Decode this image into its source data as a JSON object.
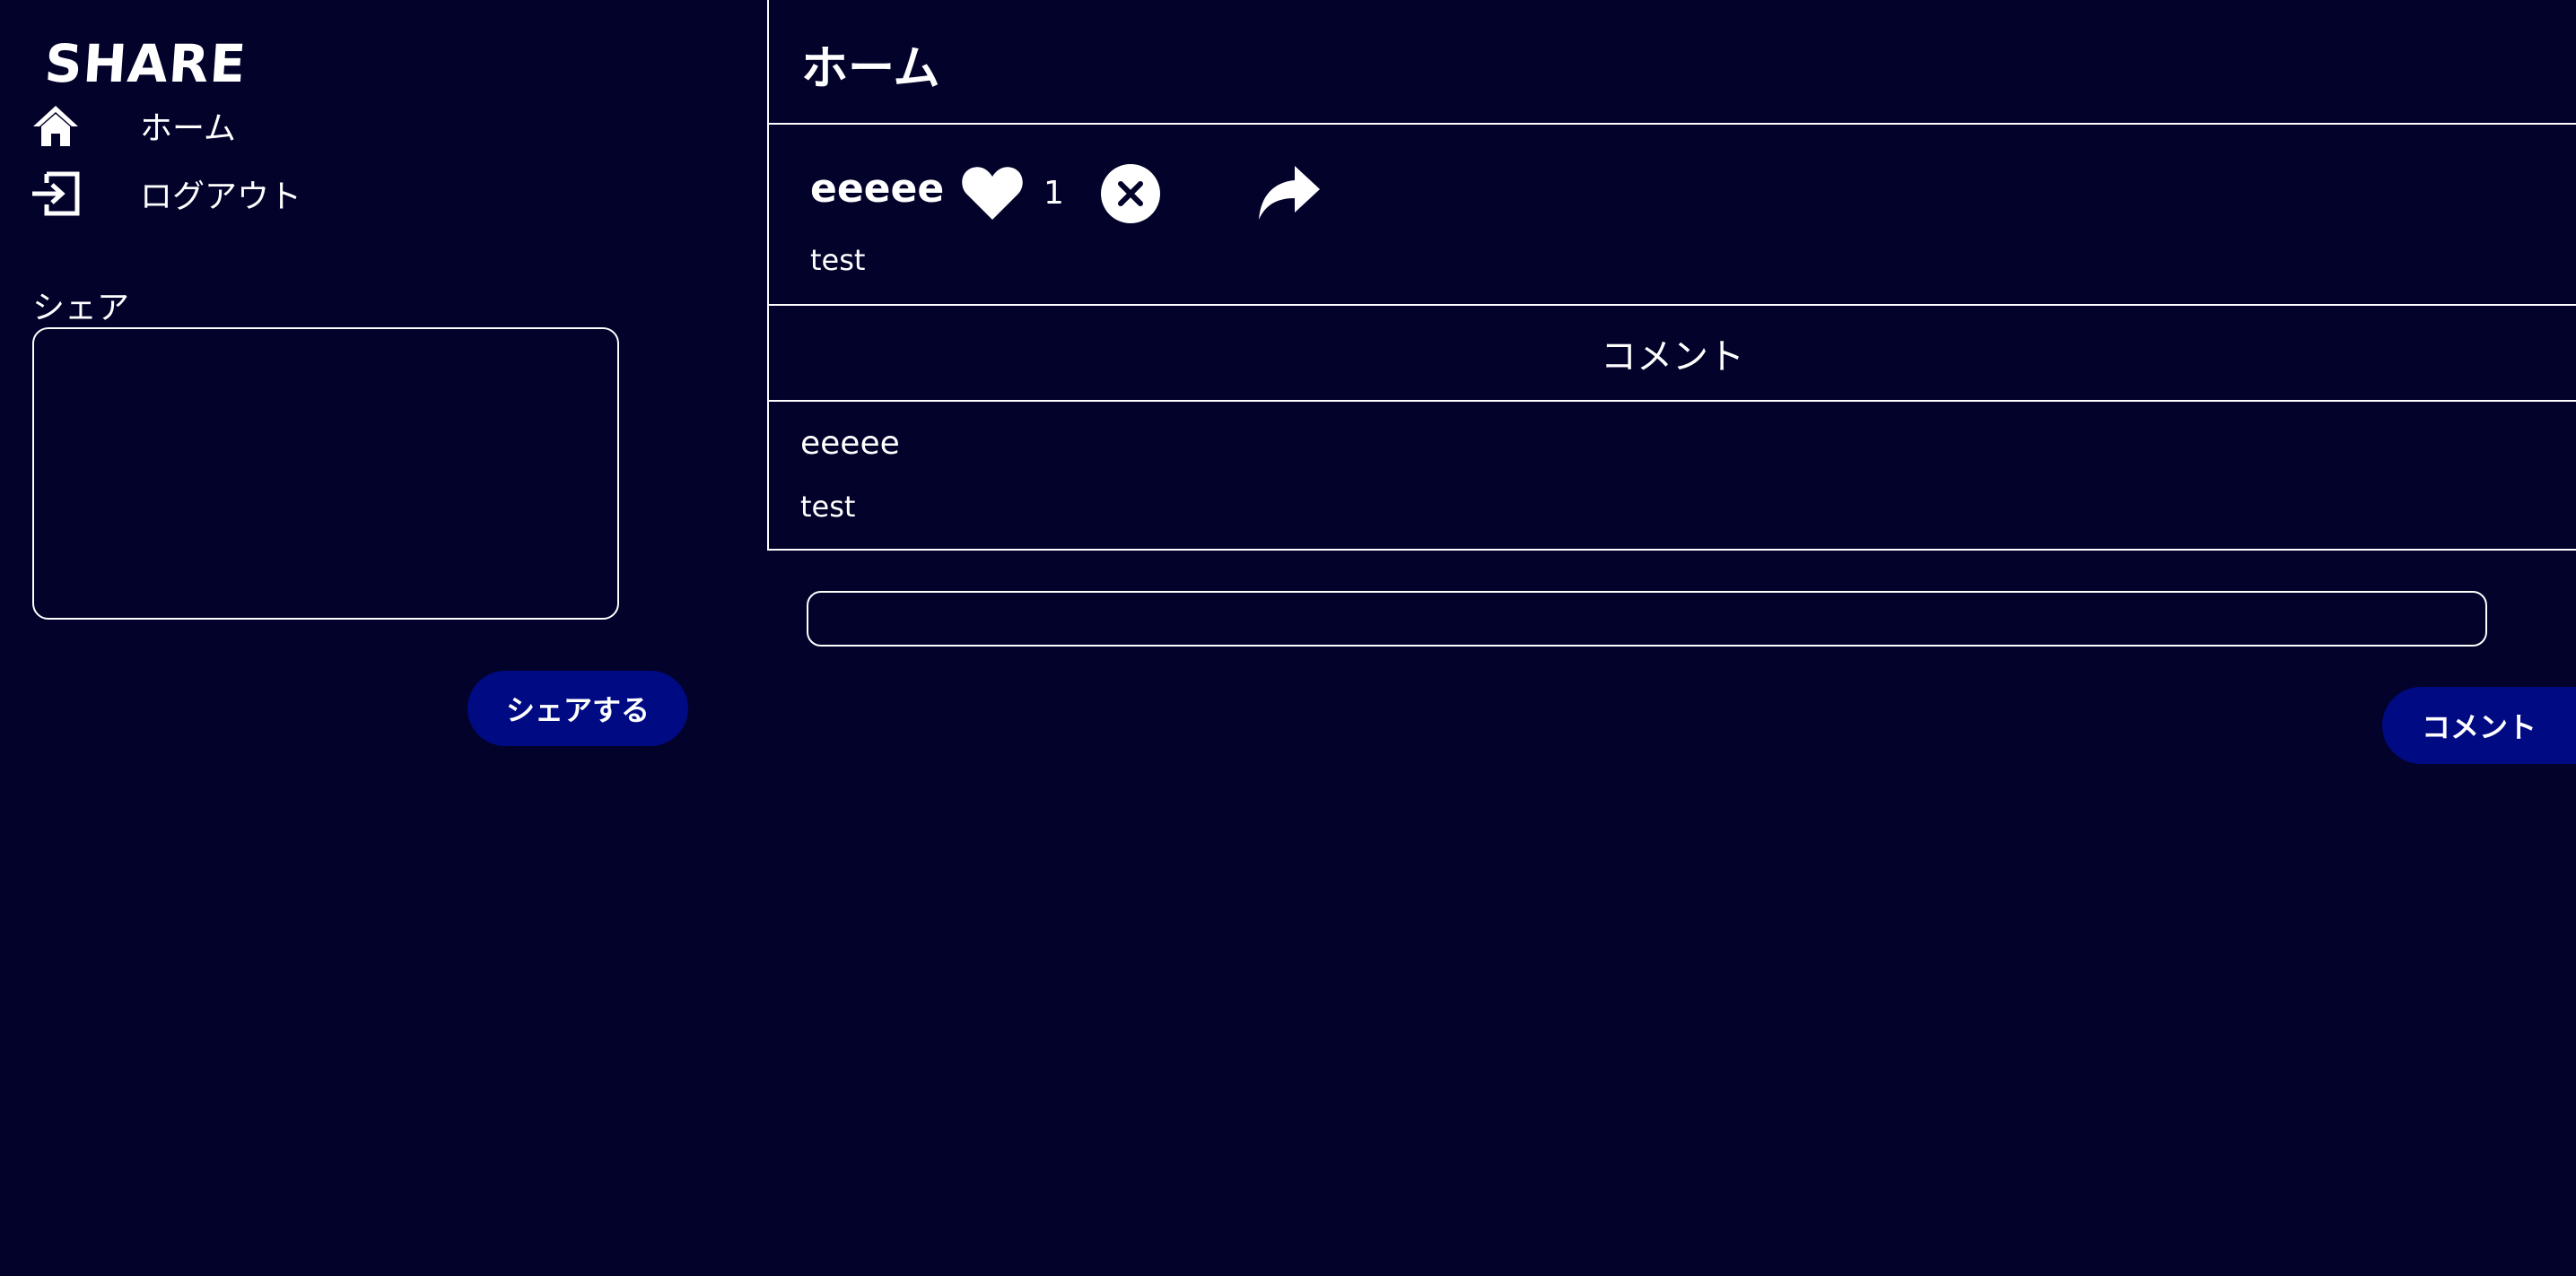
{
  "sidebar": {
    "logo": "SHARE",
    "nav": [
      {
        "label": "ホーム",
        "icon": "home-icon"
      },
      {
        "label": "ログアウト",
        "icon": "logout-icon"
      }
    ],
    "share_label": "シェア",
    "share_textarea_value": "",
    "share_button_label": "シェアする"
  },
  "main": {
    "title": "ホーム",
    "post": {
      "author": "eeeee",
      "like_count": "1",
      "body": "test",
      "icons": [
        "heart-icon",
        "close-circle-icon",
        "share-arrow-icon"
      ]
    },
    "comment_section_title": "コメント",
    "comments": [
      {
        "author": "eeeee",
        "body": "test"
      }
    ],
    "comment_input_value": "",
    "comment_button_label": "コメント"
  },
  "colors": {
    "background": "#02022b",
    "button": "#000a82",
    "text": "#ffffff",
    "border": "#ffffff"
  }
}
